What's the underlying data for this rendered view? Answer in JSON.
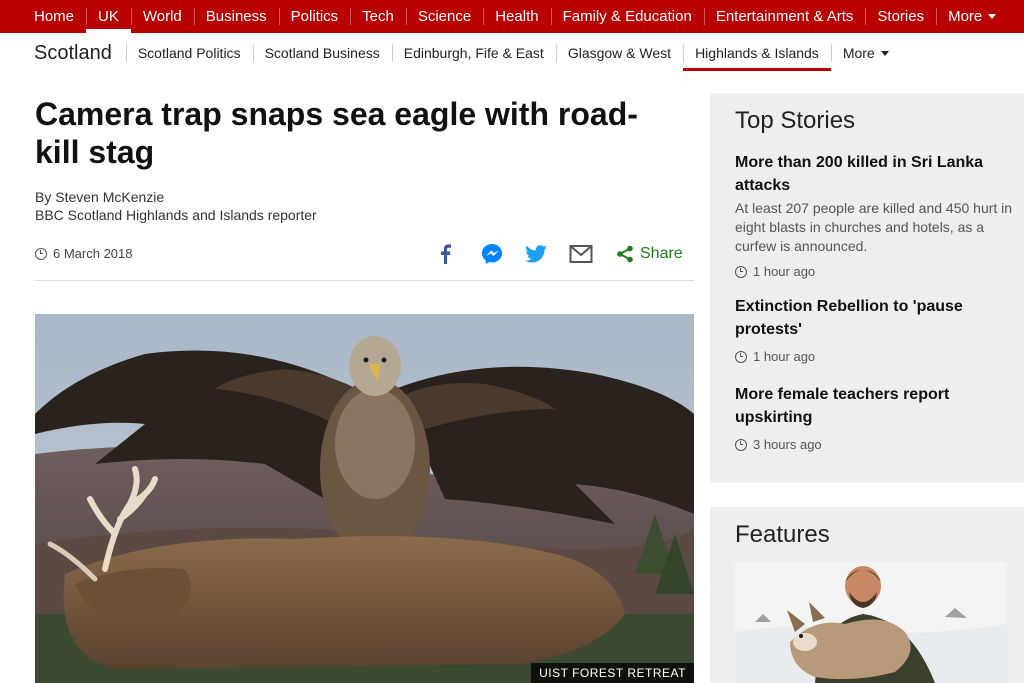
{
  "top_nav": {
    "items": [
      "Home",
      "UK",
      "World",
      "Business",
      "Politics",
      "Tech",
      "Science",
      "Health",
      "Family & Education",
      "Entertainment & Arts",
      "Stories",
      "More"
    ],
    "active": "UK"
  },
  "sub_nav": {
    "section": "Scotland",
    "items": [
      "Scotland Politics",
      "Scotland Business",
      "Edinburgh, Fife & East",
      "Glasgow & West",
      "Highlands & Islands",
      "More"
    ],
    "active": "Highlands & Islands"
  },
  "article": {
    "headline": "Camera trap snaps sea eagle with road-kill stag",
    "author": "By Steven McKenzie",
    "author_role": "BBC Scotland Highlands and Islands reporter",
    "date": "6 March 2018",
    "share_label": "Share",
    "share_icons": [
      "facebook-icon",
      "messenger-icon",
      "twitter-icon",
      "email-icon",
      "share-icon"
    ],
    "image_credit": "UIST FOREST RETREAT"
  },
  "top_stories": {
    "title": "Top Stories",
    "items": [
      {
        "title": "More than 200 killed in Sri Lanka attacks",
        "summary": "At least 207 people are killed and 450 hurt in eight blasts in churches and hotels, as a curfew is announced.",
        "time": "1 hour ago"
      },
      {
        "title": "Extinction Rebellion to 'pause protests'",
        "summary": "",
        "time": "1 hour ago"
      },
      {
        "title": "More female teachers report upskirting",
        "summary": "",
        "time": "3 hours ago"
      }
    ]
  },
  "features": {
    "title": "Features"
  },
  "colors": {
    "brand_red": "#b80000",
    "share_green": "#1d7e1d",
    "facebook": "#3b5998",
    "messenger": "#0084ff",
    "twitter": "#1da1f2",
    "sidebar_bg": "#eeeeee"
  }
}
